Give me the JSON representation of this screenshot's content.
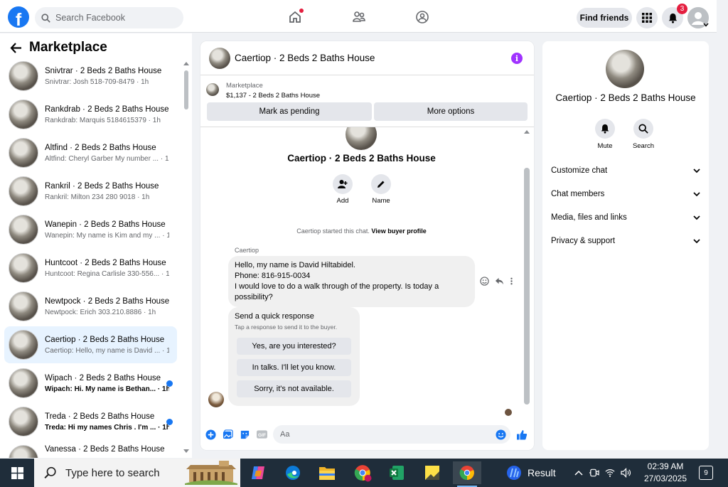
{
  "topbar": {
    "search_placeholder": "Search Facebook",
    "find_friends": "Find friends",
    "notifications_count": "3"
  },
  "sidebar": {
    "title": "Marketplace",
    "conversations": [
      {
        "title": "Snivtrar · 2 Beds 2 Baths House",
        "preview": "Snivtrar: Josh 518-709-8479 · 1h",
        "unread": false
      },
      {
        "title": "Rankdrab · 2 Beds 2 Baths House",
        "preview": "Rankdrab: Marquis 5184615379 · 1h",
        "unread": false
      },
      {
        "title": "Altfind · 2 Beds 2 Baths House",
        "preview": "Altfind: Cheryl Garber My number ... · 1h",
        "unread": false
      },
      {
        "title": "Rankril · 2 Beds 2 Baths House",
        "preview": "Rankril: Milton 234 280 9018 · 1h",
        "unread": false
      },
      {
        "title": "Wanepin · 2 Beds 2 Baths House",
        "preview": "Wanepin: My name is Kim and my ... · 1h",
        "unread": false
      },
      {
        "title": "Huntcoot · 2 Beds 2 Baths House",
        "preview": "Huntcoot: Regina Carlisle 330-556... · 1h",
        "unread": false
      },
      {
        "title": "Newtpock · 2 Beds 2 Baths House",
        "preview": "Newtpock: Erich 303.210.8886 · 1h",
        "unread": false
      },
      {
        "title": "Caertiop · 2 Beds 2 Baths House",
        "preview": "Caertiop: Hello, my name is David ... · 1h",
        "unread": false,
        "active": true
      },
      {
        "title": "Wipach · 2 Beds 2 Baths House",
        "preview": "Wipach: Hi. My name is Bethan... · 1h",
        "unread": true
      },
      {
        "title": "Treda · 2 Beds 2 Baths House",
        "preview": "Treda: Hi my names Chris . I'm ... · 1h",
        "unread": true
      },
      {
        "title": "Vanessa · 2 Beds 2 Baths House",
        "preview": "",
        "unread": false
      }
    ]
  },
  "chat": {
    "header_title": "Caertiop · 2 Beds 2 Baths House",
    "marketplace_label": "Marketplace",
    "listing": "$1,137 - 2 Beds 2 Baths House",
    "mark_pending": "Mark as pending",
    "more_options": "More options",
    "title": "Caertiop · 2 Beds 2 Baths House",
    "add_label": "Add",
    "name_label": "Name",
    "system_text": "Caertiop started this chat.",
    "view_profile": "View buyer profile",
    "sender": "Caertiop",
    "message_lines": [
      "Hello, my name is David Hiltabidel.",
      "Phone: 816-915-0034",
      "I would love to do a walk through of the property. Is today a",
      "possibility?"
    ],
    "quick_title": "Send a quick response",
    "quick_sub": "Tap a response to send it to the buyer.",
    "quick_replies": [
      "Yes, are you interested?",
      "In talks. I'll let you know.",
      "Sorry, it's not available."
    ],
    "input_placeholder": "Aa"
  },
  "details": {
    "name": "Caertiop · 2 Beds 2 Baths House",
    "mute": "Mute",
    "search": "Search",
    "sections": [
      "Customize chat",
      "Chat members",
      "Media, files and links",
      "Privacy & support"
    ]
  },
  "taskbar": {
    "search_placeholder": "Type here to search",
    "result_label": "Result",
    "time": "02:39 AM",
    "date": "27/03/2025",
    "notification_count": "9"
  },
  "colors": {
    "brand": "#1877f2",
    "active_conversation": "#e7f3ff",
    "info": "#a033ff",
    "badge": "#e41e3f"
  }
}
